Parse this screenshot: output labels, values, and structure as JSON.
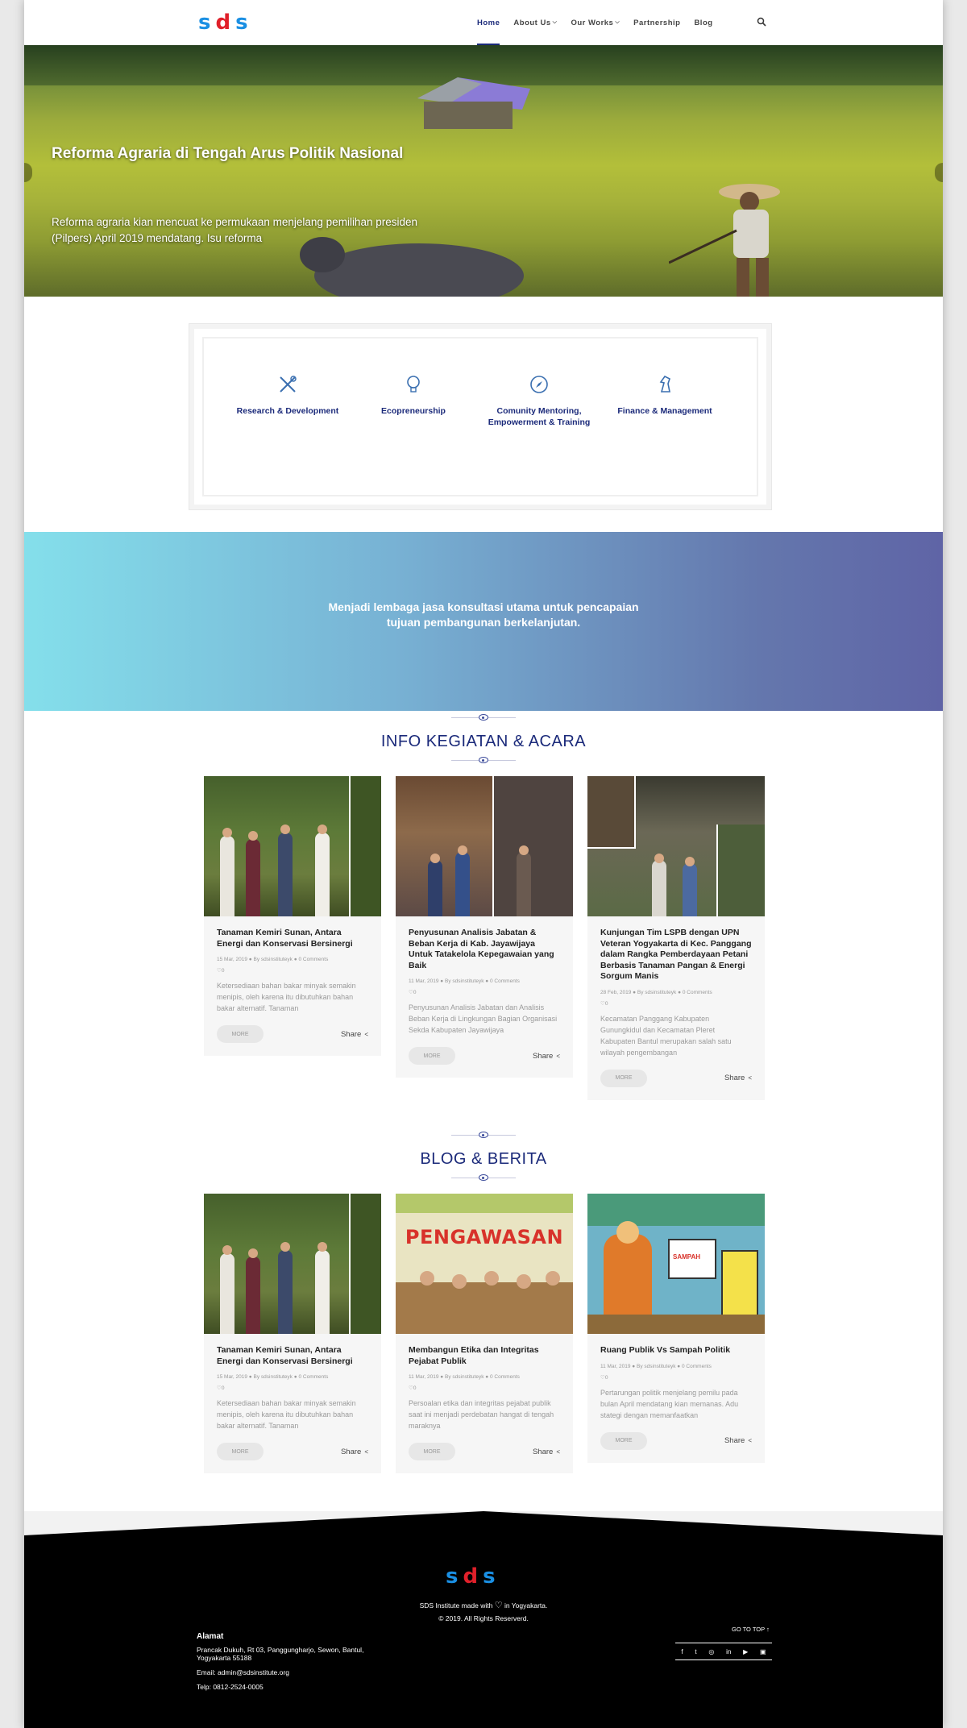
{
  "header": {
    "logo": {
      "s1": "s",
      "d": "d",
      "s2": "s"
    },
    "nav": [
      {
        "label": "Home",
        "dropdown": false,
        "active": true
      },
      {
        "label": "About Us",
        "dropdown": true,
        "active": false
      },
      {
        "label": "Our Works",
        "dropdown": true,
        "active": false
      },
      {
        "label": "Partnership",
        "dropdown": false,
        "active": false
      },
      {
        "label": "Blog",
        "dropdown": false,
        "active": false
      }
    ]
  },
  "hero": {
    "title": "Reforma Agraria di Tengah Arus Politik Nasional",
    "text": "Reforma agraria kian mencuat ke permukaan menjelang pemilihan presiden (Pilpers) April 2019 mendatang. Isu reforma"
  },
  "services": [
    {
      "label": "Research & Development",
      "icon": "tools-icon"
    },
    {
      "label": "Ecopreneurship",
      "icon": "lightbulb-icon"
    },
    {
      "label": "Comunity Mentoring, Empowerment & Training",
      "icon": "compass-icon"
    },
    {
      "label": "Finance & Management",
      "icon": "chess-knight-icon"
    }
  ],
  "banner": {
    "text": "Menjadi lembaga jasa konsultasi utama untuk pencapaian tujuan pembangunan berkelanjutan."
  },
  "events": {
    "title": "INFO KEGIATAN & ACARA",
    "cards": [
      {
        "title": "Tanaman Kemiri Sunan, Antara Energi dan Konservasi Bersinergi",
        "date": "15 Mar, 2019",
        "author": "By sdsinstituteyk",
        "comments": "0 Comments",
        "likes": "0",
        "excerpt": "Ketersediaan bahan bakar minyak semakin menipis, oleh karena itu dibutuhkan bahan bakar alternatif. Tanaman",
        "more": "MORE",
        "share": "Share"
      },
      {
        "title": "Penyusunan Analisis Jabatan & Beban Kerja di Kab. Jayawijaya Untuk Tatakelola Kepegawaian yang Baik",
        "date": "11 Mar, 2019",
        "author": "By sdsinstituteyk",
        "comments": "0 Comments",
        "likes": "0",
        "excerpt": "Penyusunan Analisis Jabatan dan Analisis Beban Kerja di Lingkungan Bagian Organisasi Sekda Kabupaten Jayawijaya",
        "more": "MORE",
        "share": "Share"
      },
      {
        "title": "Kunjungan Tim LSPB dengan UPN Veteran Yogyakarta di Kec. Panggang dalam Rangka Pemberdayaan Petani Berbasis Tanaman Pangan & Energi Sorgum Manis",
        "date": "28 Feb, 2019",
        "author": "By sdsinstituteyk",
        "comments": "0 Comments",
        "likes": "0",
        "excerpt": "Kecamatan Panggang Kabupaten Gunungkidul dan Kecamatan Pleret Kabupaten Bantul merupakan salah satu wilayah pengembangan",
        "more": "MORE",
        "share": "Share"
      }
    ]
  },
  "blog": {
    "title": "BLOG & BERITA",
    "cards": [
      {
        "title": "Tanaman Kemiri Sunan, Antara Energi dan Konservasi Bersinergi",
        "date": "15 Mar, 2019",
        "author": "By sdsinstituteyk",
        "comments": "0 Comments",
        "likes": "0",
        "excerpt": "Ketersediaan bahan bakar minyak semakin menipis, oleh karena itu dibutuhkan bahan bakar alternatif. Tanaman",
        "more": "MORE",
        "share": "Share"
      },
      {
        "title": "Membangun Etika dan Integritas Pejabat Publik",
        "date": "11 Mar, 2019",
        "author": "By sdsinstituteyk",
        "comments": "0 Comments",
        "likes": "0",
        "excerpt": "Persoalan etika dan integritas pejabat publik saat ini menjadi perdebatan hangat di tengah maraknya",
        "more": "MORE",
        "share": "Share",
        "image_text": "PENGAWASAN"
      },
      {
        "title": "Ruang Publik Vs Sampah Politik",
        "date": "11 Mar, 2019",
        "author": "By sdsinstituteyk",
        "comments": "0 Comments",
        "likes": "0",
        "excerpt": "Pertarungan politik menjelang pemilu pada bulan April mendatang kian memanas. Adu stategi dengan memanfaatkan",
        "more": "MORE",
        "share": "Share",
        "image_text": "SAMPAH"
      }
    ]
  },
  "footer": {
    "made_prefix": "SDS Institute made with",
    "made_suffix": "in Yogyakarta.",
    "copyright": "© 2019. All Rights Reserverd.",
    "address_heading": "Alamat",
    "address": "Prancak Dukuh, Rt 03, Panggungharjo, Sewon, Bantul, Yogyakarta 55188",
    "email": "Email: admin@sdsinstitute.org",
    "phone": "Telp: 0812-2524-0005",
    "go_to_top": "GO TO TOP",
    "social": [
      "facebook-icon",
      "twitter-icon",
      "dribbble-icon",
      "linkedin-icon",
      "youtube-icon",
      "instagram-icon"
    ]
  },
  "colors": {
    "accent": "#1b2a7a",
    "logo_blue": "#1a8fe3",
    "logo_red": "#e0202a",
    "banner_left": "#84dfeb",
    "banner_right": "#5f64a6"
  }
}
